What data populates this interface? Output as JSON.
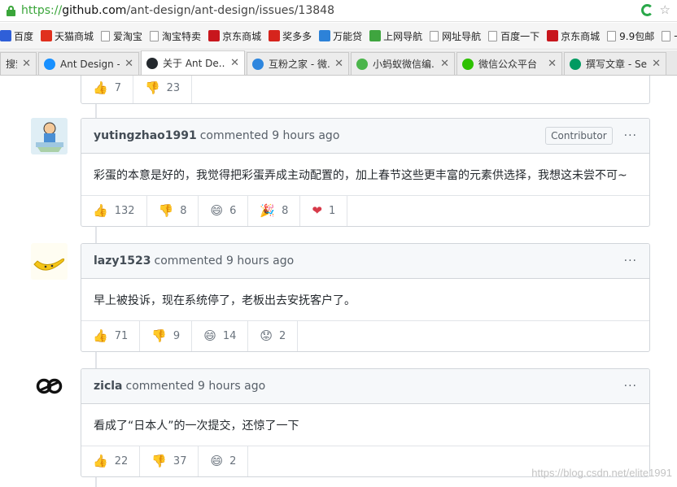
{
  "browser": {
    "url_protocol": "https://",
    "url_host": "github.com",
    "url_path": "/ant-design/ant-design/issues/13848"
  },
  "bookmarks": [
    {
      "label": "百度",
      "icon": "paw-icon",
      "color": "#2f5fd8"
    },
    {
      "label": "天猫商城",
      "icon": "tmall-icon",
      "color": "#e0301e"
    },
    {
      "label": "爱淘宝",
      "icon": "page-icon",
      "color": ""
    },
    {
      "label": "淘宝特卖",
      "icon": "page-icon",
      "color": ""
    },
    {
      "label": "京东商城",
      "icon": "jd-icon",
      "color": "#c8161d"
    },
    {
      "label": "奖多多",
      "icon": "jdd-icon",
      "color": "#d6241d"
    },
    {
      "label": "万能贷",
      "icon": "wnd-icon",
      "color": "#2d82d8"
    },
    {
      "label": "上网导航",
      "icon": "nav-icon",
      "color": "#3fa53f"
    },
    {
      "label": "网址导航",
      "icon": "page-icon",
      "color": ""
    },
    {
      "label": "百度一下",
      "icon": "page-icon",
      "color": ""
    },
    {
      "label": "京东商城",
      "icon": "jd-icon",
      "color": "#c8161d"
    },
    {
      "label": "9.9包邮",
      "icon": "page-icon",
      "color": ""
    },
    {
      "label": "一",
      "icon": "page-icon",
      "color": ""
    }
  ],
  "tabs": [
    {
      "label": "搜索",
      "icon": "",
      "color": "",
      "active": false
    },
    {
      "label": "Ant Design - ...",
      "icon": "ant-icon",
      "color": "#1890ff",
      "active": false
    },
    {
      "label": "关于 Ant De...",
      "icon": "github-icon",
      "color": "#24292e",
      "active": true
    },
    {
      "label": "互粉之家 - 微...",
      "icon": "globe-icon",
      "color": "#2e86de",
      "active": false
    },
    {
      "label": "小蚂蚁微信编...",
      "icon": "ant-green-icon",
      "color": "#4bb54b",
      "active": false
    },
    {
      "label": "微信公众平台",
      "icon": "wechat-icon",
      "color": "#2dc100",
      "active": false
    },
    {
      "label": "撰写文章 - Se...",
      "icon": "sf-icon",
      "color": "#009a61",
      "active": false
    }
  ],
  "comments": [
    {
      "author": "",
      "action": "",
      "time": "",
      "badge": "",
      "body": "",
      "reactions": [
        {
          "emoji": "👍",
          "type": "thumb",
          "count": "7"
        },
        {
          "emoji": "👎",
          "type": "thumb",
          "count": "23"
        }
      ]
    },
    {
      "author": "yutingzhao1991",
      "action": "commented",
      "time": "9 hours ago",
      "badge": "Contributor",
      "body": "彩蛋的本意是好的，我觉得把彩蛋弄成主动配置的，加上春节这些更丰富的元素供选择，我想这未尝不可~",
      "reactions": [
        {
          "emoji": "👍",
          "type": "thumb",
          "count": "132"
        },
        {
          "emoji": "👎",
          "type": "thumb",
          "count": "8"
        },
        {
          "emoji": "😄",
          "type": "smile",
          "count": "6"
        },
        {
          "emoji": "🎉",
          "type": "hooray",
          "count": "8"
        },
        {
          "emoji": "❤",
          "type": "heart",
          "count": "1"
        }
      ]
    },
    {
      "author": "lazy1523",
      "action": "commented",
      "time": "9 hours ago",
      "badge": "",
      "body": "早上被投诉，现在系统停了，老板出去安抚客户了。",
      "reactions": [
        {
          "emoji": "👍",
          "type": "thumb",
          "count": "71"
        },
        {
          "emoji": "👎",
          "type": "thumb",
          "count": "9"
        },
        {
          "emoji": "😄",
          "type": "smile",
          "count": "14"
        },
        {
          "emoji": "😟",
          "type": "confused",
          "count": "2"
        }
      ]
    },
    {
      "author": "zicla",
      "action": "commented",
      "time": "9 hours ago",
      "badge": "",
      "body": "看成了“日本人”的一次提交，还惊了一下",
      "reactions": [
        {
          "emoji": "👍",
          "type": "thumb",
          "count": "22"
        },
        {
          "emoji": "👎",
          "type": "thumb",
          "count": "37"
        },
        {
          "emoji": "😄",
          "type": "smile",
          "count": "2"
        }
      ]
    }
  ],
  "more_label": "···",
  "watermark": "https://blog.csdn.net/elite1991"
}
